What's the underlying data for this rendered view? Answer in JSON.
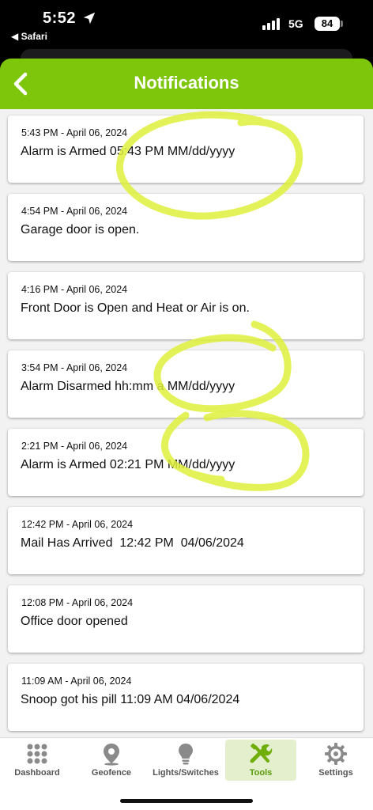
{
  "status_bar": {
    "time": "5:52",
    "back_app": "◀ Safari",
    "network": "5G",
    "battery": "84"
  },
  "header": {
    "title": "Notifications",
    "back_icon": "chevron-left-icon"
  },
  "notifications": [
    {
      "time": "5:43 PM - April 06, 2024",
      "message": "Alarm is Armed 05:43 PM MM/dd/yyyy"
    },
    {
      "time": "4:54 PM - April 06, 2024",
      "message": "Garage door is open."
    },
    {
      "time": "4:16 PM - April 06, 2024",
      "message": "Front Door is Open and Heat or Air is on."
    },
    {
      "time": "3:54 PM - April 06, 2024",
      "message": "Alarm Disarmed hh:mm a MM/dd/yyyy"
    },
    {
      "time": "2:21 PM - April 06, 2024",
      "message": "Alarm is Armed 02:21 PM MM/dd/yyyy"
    },
    {
      "time": "12:42 PM - April 06, 2024",
      "message": "Mail Has Arrived  12:42 PM  04/06/2024"
    },
    {
      "time": "12:08 PM - April 06, 2024",
      "message": "Office door opened"
    },
    {
      "time": "11:09 AM - April 06, 2024",
      "message": "Snoop got his pill 11:09 AM 04/06/2024"
    }
  ],
  "tabs": [
    {
      "label": "Dashboard",
      "icon": "grid-dots-icon"
    },
    {
      "label": "Geofence",
      "icon": "map-pin-icon"
    },
    {
      "label": "Lights/Switches",
      "icon": "lightbulb-icon"
    },
    {
      "label": "Tools",
      "icon": "tools-icon",
      "active": true
    },
    {
      "label": "Settings",
      "icon": "gear-icon"
    }
  ],
  "colors": {
    "accent": "#7dc60c",
    "highlight": "#dff03c",
    "active_tab_bg": "#e3efcd"
  }
}
